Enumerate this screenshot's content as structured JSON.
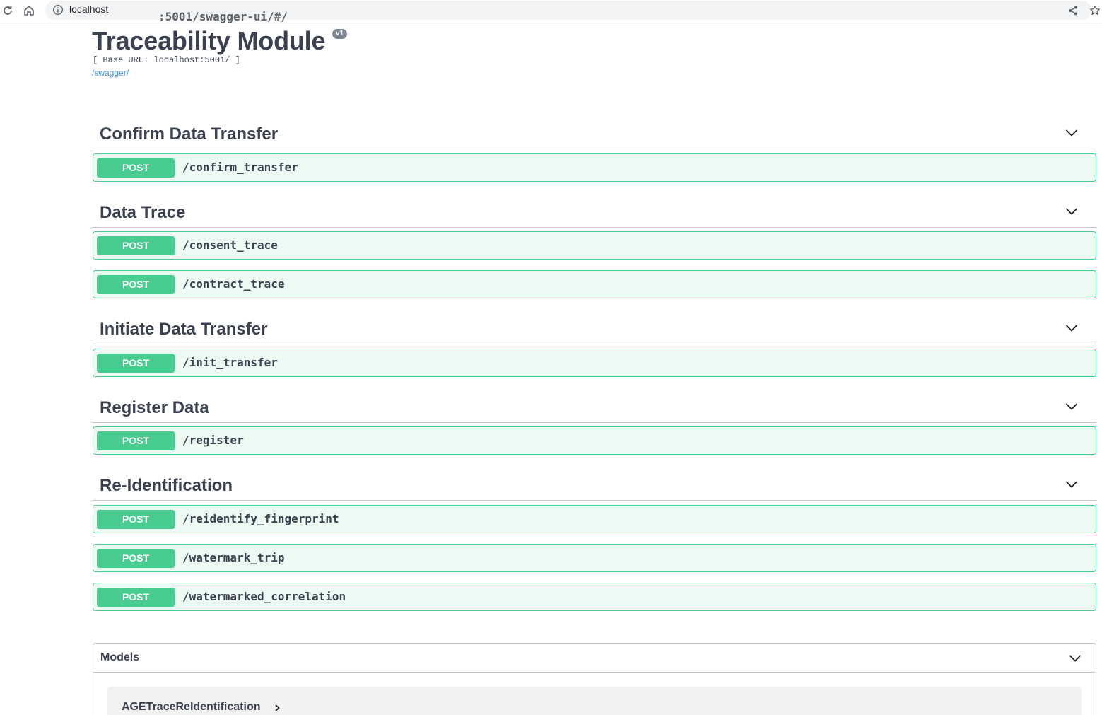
{
  "browser": {
    "url_host": "localhost",
    "url_rest": ":5001/swagger-ui/#/"
  },
  "info": {
    "title": "Traceability Module",
    "version": "v1",
    "base_url": "[ Base URL: localhost:5001/ ]",
    "spec_link": "/swagger/"
  },
  "tags": [
    {
      "name": "Confirm Data Transfer",
      "operations": [
        {
          "method": "POST",
          "path": "/confirm_transfer"
        }
      ]
    },
    {
      "name": "Data Trace",
      "operations": [
        {
          "method": "POST",
          "path": "/consent_trace"
        },
        {
          "method": "POST",
          "path": "/contract_trace"
        }
      ]
    },
    {
      "name": "Initiate Data Transfer",
      "operations": [
        {
          "method": "POST",
          "path": "/init_transfer"
        }
      ]
    },
    {
      "name": "Register Data",
      "operations": [
        {
          "method": "POST",
          "path": "/register"
        }
      ]
    },
    {
      "name": "Re-Identification",
      "operations": [
        {
          "method": "POST",
          "path": "/reidentify_fingerprint"
        },
        {
          "method": "POST",
          "path": "/watermark_trip"
        },
        {
          "method": "POST",
          "path": "/watermarked_correlation"
        }
      ]
    }
  ],
  "models": {
    "title": "Models",
    "items": [
      "AGETraceReIdentification"
    ]
  },
  "colors": {
    "post": "#49cc90",
    "text": "#3b4151",
    "link": "#4990e2"
  }
}
